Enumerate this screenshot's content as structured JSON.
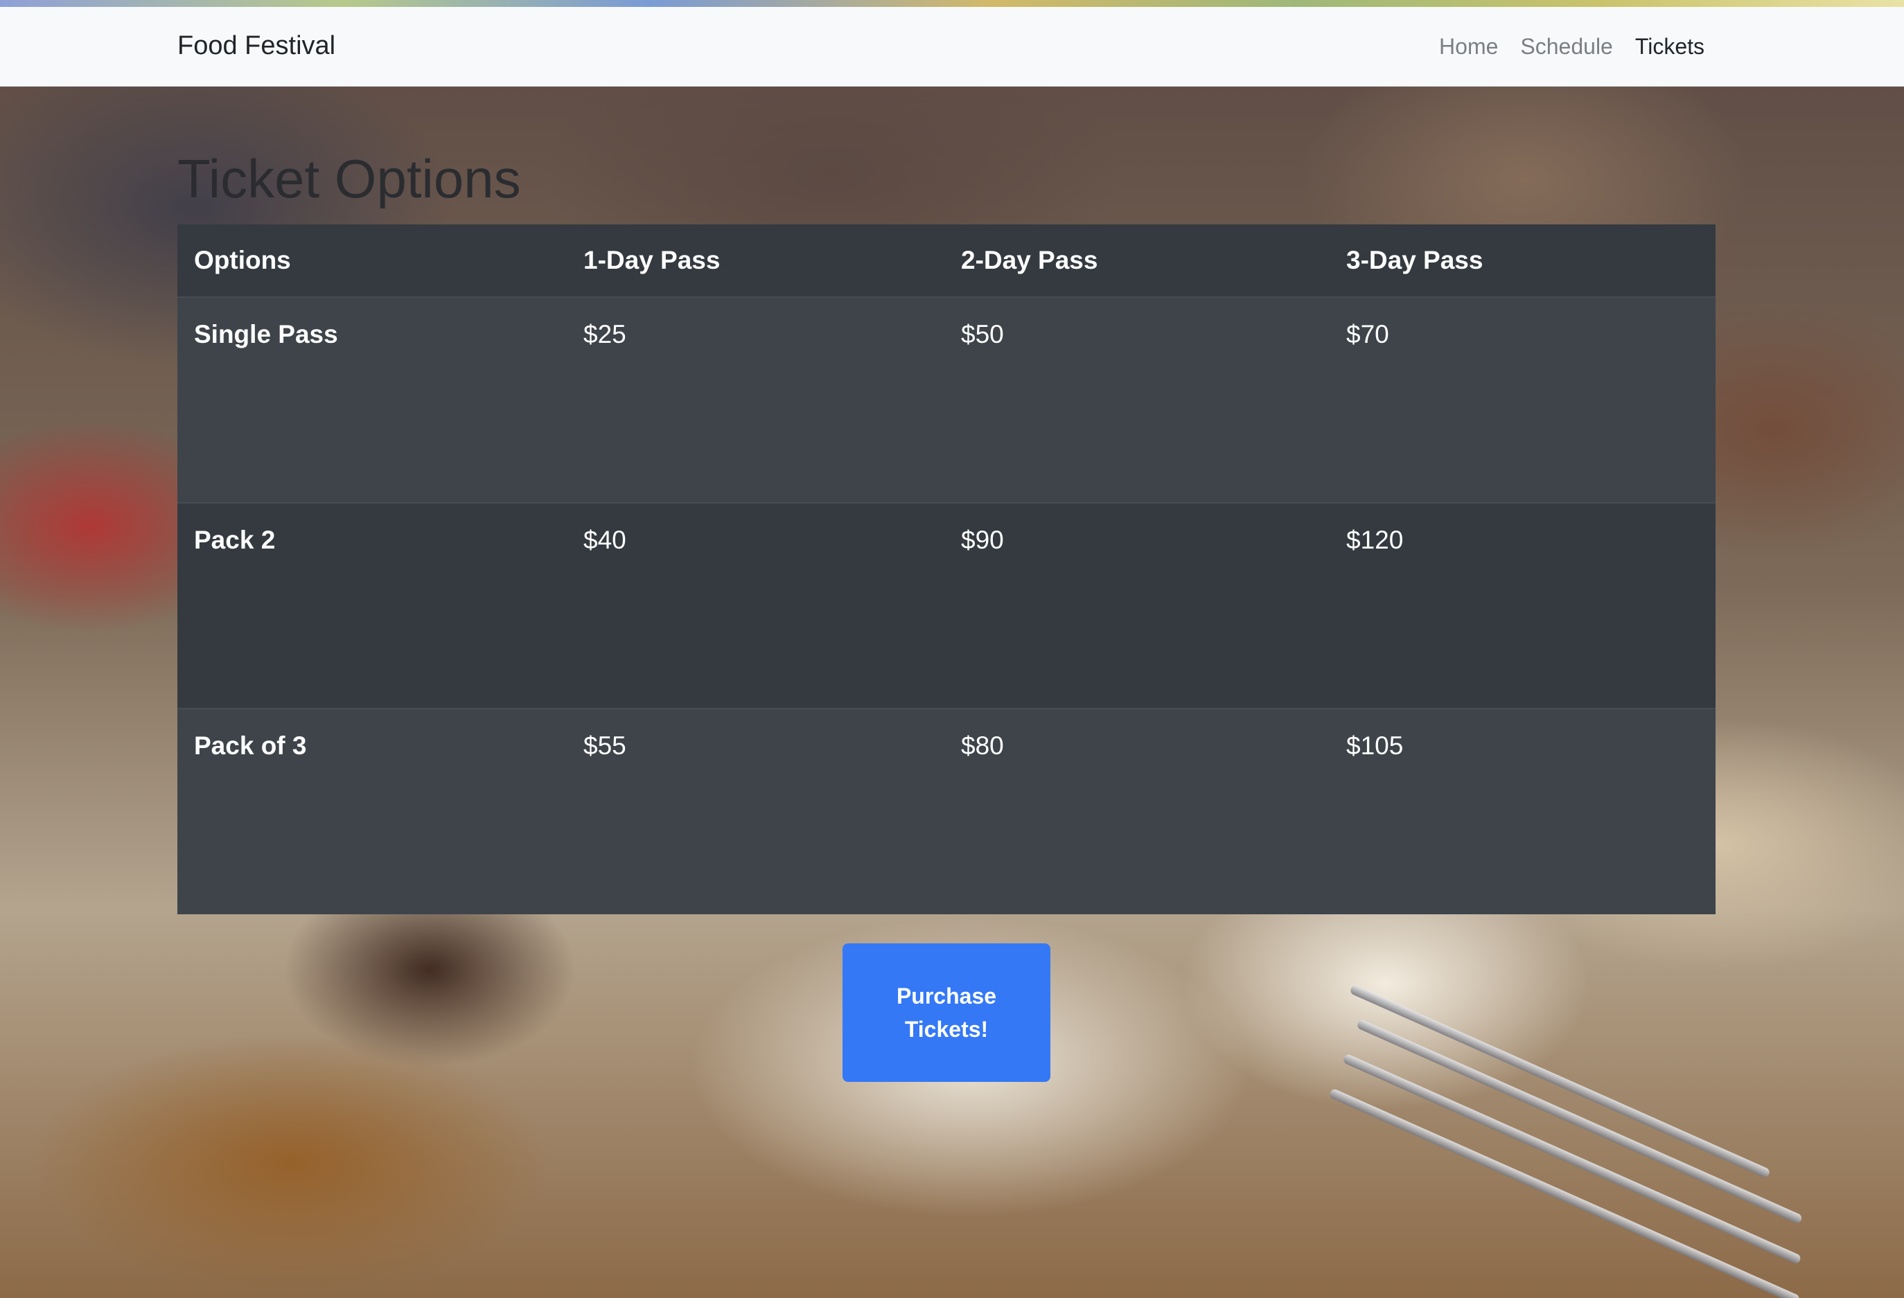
{
  "navbar": {
    "brand": "Food Festival",
    "links": [
      {
        "label": "Home",
        "active": false
      },
      {
        "label": "Schedule",
        "active": false
      },
      {
        "label": "Tickets",
        "active": true
      }
    ]
  },
  "main": {
    "title": "Ticket Options",
    "table": {
      "headers": [
        "Options",
        "1-Day Pass",
        "2-Day Pass",
        "3-Day Pass"
      ],
      "rows": [
        [
          "Single Pass",
          "$25",
          "$50",
          "$70"
        ],
        [
          "Pack 2",
          "$40",
          "$90",
          "$120"
        ],
        [
          "Pack of 3",
          "$55",
          "$80",
          "$105"
        ]
      ]
    },
    "purchase_button": "Purchase Tickets!"
  },
  "colors": {
    "navbar_bg": "#f8f9fa",
    "table_dark": "#343a40",
    "table_stripe": "#3e444a",
    "button_primary": "#3478f6"
  }
}
